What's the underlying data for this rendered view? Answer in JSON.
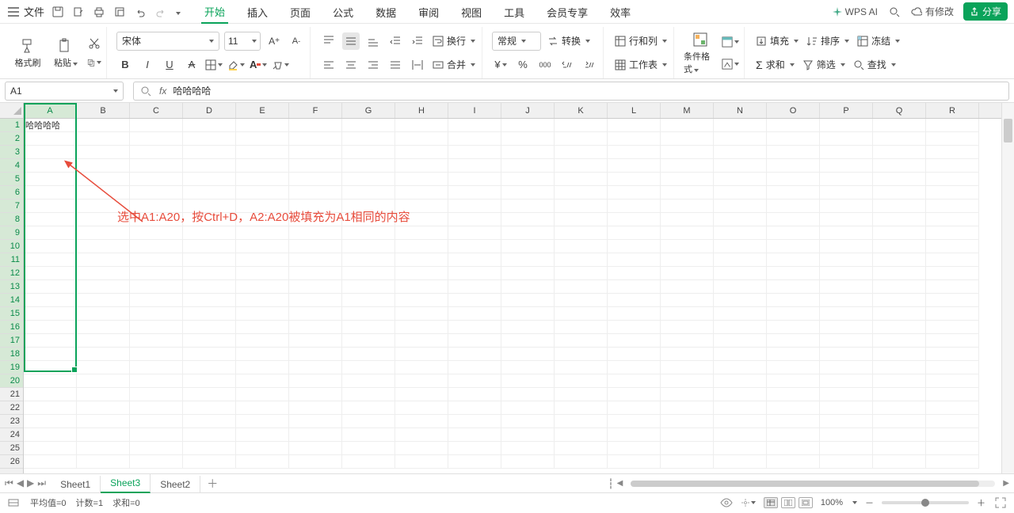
{
  "menubar": {
    "file_label": "文件",
    "menus": [
      "开始",
      "插入",
      "页面",
      "公式",
      "数据",
      "审阅",
      "视图",
      "工具",
      "会员专享",
      "效率"
    ],
    "active_menu_index": 0,
    "wps_ai": "WPS AI",
    "modified": "有修改",
    "share": "分享"
  },
  "ribbon": {
    "format_painter": "格式刷",
    "paste": "粘贴",
    "font_name": "宋体",
    "font_size": "11",
    "number_format": "常规",
    "convert": "转换",
    "wrap": "换行",
    "merge": "合并",
    "rows_cols": "行和列",
    "worksheet": "工作表",
    "cond_format": "条件格式",
    "fill": "填充",
    "sort": "排序",
    "freeze": "冻结",
    "sum": "求和",
    "filter": "筛选",
    "find": "查找"
  },
  "namebox": {
    "ref": "A1"
  },
  "formula": {
    "value": "哈哈哈哈"
  },
  "grid": {
    "columns": [
      "A",
      "B",
      "C",
      "D",
      "E",
      "F",
      "G",
      "H",
      "I",
      "J",
      "K",
      "L",
      "M",
      "N",
      "O",
      "P",
      "Q",
      "R"
    ],
    "row_count": 26,
    "selected_col_index": 0,
    "selected_rows_from": 1,
    "selected_rows_to": 20,
    "a1_value": "哈哈哈哈"
  },
  "annotation": {
    "text": "选中A1:A20，按Ctrl+D，A2:A20被填充为A1相同的内容"
  },
  "tabs": {
    "sheets": [
      "Sheet1",
      "Sheet3",
      "Sheet2"
    ],
    "active_index": 1
  },
  "status": {
    "avg": "平均值=0",
    "count": "计数=1",
    "sum": "求和=0",
    "zoom": "100%"
  }
}
